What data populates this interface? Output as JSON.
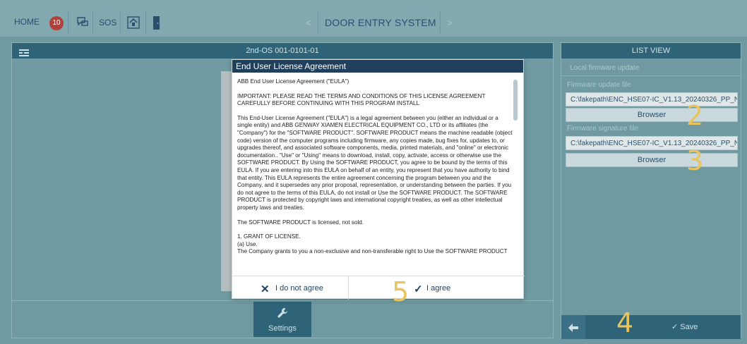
{
  "topbar": {
    "home_label": "HOME",
    "notification_count": "10",
    "sos_label": "SOS",
    "title": "DOOR ENTRY SYSTEM",
    "prev_chevron": "<",
    "next_chevron": ">"
  },
  "left_panel": {
    "device_name": "2nd-OS 001-0101-01",
    "settings_label": "Settings"
  },
  "right_panel": {
    "header": "LIST VIEW",
    "section_title": "Local firmware update",
    "update_file_label": "Firmware update file",
    "update_file_path": "C:\\fakepath\\ENC_HSE07-IC_V1.13_20240326_PP_NG",
    "browse_label_1": "Browser",
    "signature_file_label": "Firmware signature file",
    "signature_file_path": "C:\\fakepath\\ENC_HSE07-IC_V1.13_20240326_PP_NG",
    "browse_label_2": "Browser",
    "save_label": "Save"
  },
  "annotations": {
    "step2": "2",
    "step3": "3",
    "step4": "4",
    "step5": "5"
  },
  "modal": {
    "title": "End User License Agreement",
    "paragraphs": [
      "ABB End User License Agreement (\"EULA\")",
      "IMPORTANT: PLEASE READ THE TERMS AND CONDITIONS OF THIS LICENSE AGREEMENT CAREFULLY BEFORE CONTINUING WITH THIS PROGRAM INSTALL",
      "This End-User License Agreement (\"EULA\") is a legal agreement between you (either an individual or a single entity) and ABB GENWAY XIAMEN ELECTRICAL EQUIPMENT CO., LTD or its affiliates (the \"Company\") for the \"SOFTWARE PRODUCT\". SOFTWARE PRODUCT means the machine readable (object code) version of the computer programs including firmware, any copies made, bug fixes for, updates to, or upgrades thereof, and associated software components, media, printed materials, and \"online\" or electronic documentation.. \"Use\" or \"Using\" means to download, install, copy, activate, access or otherwise use the SOFTWARE PRODUCT. By Using the SOFTWARE PRODUCT, you agree to be bound by the terms of this EULA. If you are entering into this EULA on behalf of an entity, you represent that you have authority to bind that entity. This EULA represents the entire agreement concerning the program between you and the Company, and it supersedes any prior proposal, representation, or understanding between the parties. If you do not agree to the terms of this EULA, do not install or Use the SOFTWARE PRODUCT. The SOFTWARE PRODUCT is protected by copyright laws and international copyright treaties, as well as other intellectual property laws and treaties.",
      "The SOFTWARE PRODUCT is licensed, not sold.",
      "1. GRANT OF LICENSE.",
      "(a) Use.",
      "The Company grants to you a non-exclusive and non-transferable right to Use the SOFTWARE PRODUCT"
    ],
    "decline_label": "I do not agree",
    "accept_label": "I agree"
  }
}
